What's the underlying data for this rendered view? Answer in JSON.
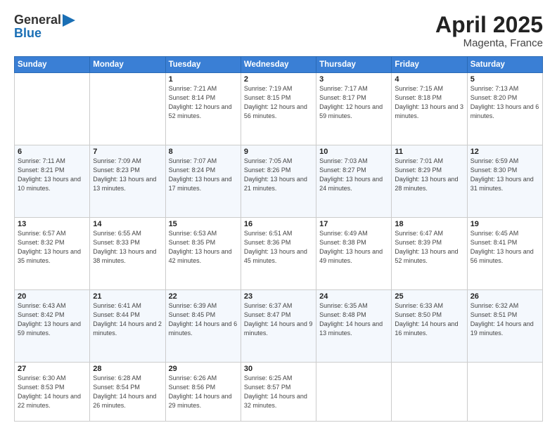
{
  "header": {
    "logo_general": "General",
    "logo_blue": "Blue",
    "month": "April 2025",
    "location": "Magenta, France"
  },
  "weekdays": [
    "Sunday",
    "Monday",
    "Tuesday",
    "Wednesday",
    "Thursday",
    "Friday",
    "Saturday"
  ],
  "weeks": [
    [
      {
        "day": "",
        "info": ""
      },
      {
        "day": "",
        "info": ""
      },
      {
        "day": "1",
        "info": "Sunrise: 7:21 AM\nSunset: 8:14 PM\nDaylight: 12 hours and 52 minutes."
      },
      {
        "day": "2",
        "info": "Sunrise: 7:19 AM\nSunset: 8:15 PM\nDaylight: 12 hours and 56 minutes."
      },
      {
        "day": "3",
        "info": "Sunrise: 7:17 AM\nSunset: 8:17 PM\nDaylight: 12 hours and 59 minutes."
      },
      {
        "day": "4",
        "info": "Sunrise: 7:15 AM\nSunset: 8:18 PM\nDaylight: 13 hours and 3 minutes."
      },
      {
        "day": "5",
        "info": "Sunrise: 7:13 AM\nSunset: 8:20 PM\nDaylight: 13 hours and 6 minutes."
      }
    ],
    [
      {
        "day": "6",
        "info": "Sunrise: 7:11 AM\nSunset: 8:21 PM\nDaylight: 13 hours and 10 minutes."
      },
      {
        "day": "7",
        "info": "Sunrise: 7:09 AM\nSunset: 8:23 PM\nDaylight: 13 hours and 13 minutes."
      },
      {
        "day": "8",
        "info": "Sunrise: 7:07 AM\nSunset: 8:24 PM\nDaylight: 13 hours and 17 minutes."
      },
      {
        "day": "9",
        "info": "Sunrise: 7:05 AM\nSunset: 8:26 PM\nDaylight: 13 hours and 21 minutes."
      },
      {
        "day": "10",
        "info": "Sunrise: 7:03 AM\nSunset: 8:27 PM\nDaylight: 13 hours and 24 minutes."
      },
      {
        "day": "11",
        "info": "Sunrise: 7:01 AM\nSunset: 8:29 PM\nDaylight: 13 hours and 28 minutes."
      },
      {
        "day": "12",
        "info": "Sunrise: 6:59 AM\nSunset: 8:30 PM\nDaylight: 13 hours and 31 minutes."
      }
    ],
    [
      {
        "day": "13",
        "info": "Sunrise: 6:57 AM\nSunset: 8:32 PM\nDaylight: 13 hours and 35 minutes."
      },
      {
        "day": "14",
        "info": "Sunrise: 6:55 AM\nSunset: 8:33 PM\nDaylight: 13 hours and 38 minutes."
      },
      {
        "day": "15",
        "info": "Sunrise: 6:53 AM\nSunset: 8:35 PM\nDaylight: 13 hours and 42 minutes."
      },
      {
        "day": "16",
        "info": "Sunrise: 6:51 AM\nSunset: 8:36 PM\nDaylight: 13 hours and 45 minutes."
      },
      {
        "day": "17",
        "info": "Sunrise: 6:49 AM\nSunset: 8:38 PM\nDaylight: 13 hours and 49 minutes."
      },
      {
        "day": "18",
        "info": "Sunrise: 6:47 AM\nSunset: 8:39 PM\nDaylight: 13 hours and 52 minutes."
      },
      {
        "day": "19",
        "info": "Sunrise: 6:45 AM\nSunset: 8:41 PM\nDaylight: 13 hours and 56 minutes."
      }
    ],
    [
      {
        "day": "20",
        "info": "Sunrise: 6:43 AM\nSunset: 8:42 PM\nDaylight: 13 hours and 59 minutes."
      },
      {
        "day": "21",
        "info": "Sunrise: 6:41 AM\nSunset: 8:44 PM\nDaylight: 14 hours and 2 minutes."
      },
      {
        "day": "22",
        "info": "Sunrise: 6:39 AM\nSunset: 8:45 PM\nDaylight: 14 hours and 6 minutes."
      },
      {
        "day": "23",
        "info": "Sunrise: 6:37 AM\nSunset: 8:47 PM\nDaylight: 14 hours and 9 minutes."
      },
      {
        "day": "24",
        "info": "Sunrise: 6:35 AM\nSunset: 8:48 PM\nDaylight: 14 hours and 13 minutes."
      },
      {
        "day": "25",
        "info": "Sunrise: 6:33 AM\nSunset: 8:50 PM\nDaylight: 14 hours and 16 minutes."
      },
      {
        "day": "26",
        "info": "Sunrise: 6:32 AM\nSunset: 8:51 PM\nDaylight: 14 hours and 19 minutes."
      }
    ],
    [
      {
        "day": "27",
        "info": "Sunrise: 6:30 AM\nSunset: 8:53 PM\nDaylight: 14 hours and 22 minutes."
      },
      {
        "day": "28",
        "info": "Sunrise: 6:28 AM\nSunset: 8:54 PM\nDaylight: 14 hours and 26 minutes."
      },
      {
        "day": "29",
        "info": "Sunrise: 6:26 AM\nSunset: 8:56 PM\nDaylight: 14 hours and 29 minutes."
      },
      {
        "day": "30",
        "info": "Sunrise: 6:25 AM\nSunset: 8:57 PM\nDaylight: 14 hours and 32 minutes."
      },
      {
        "day": "",
        "info": ""
      },
      {
        "day": "",
        "info": ""
      },
      {
        "day": "",
        "info": ""
      }
    ]
  ]
}
